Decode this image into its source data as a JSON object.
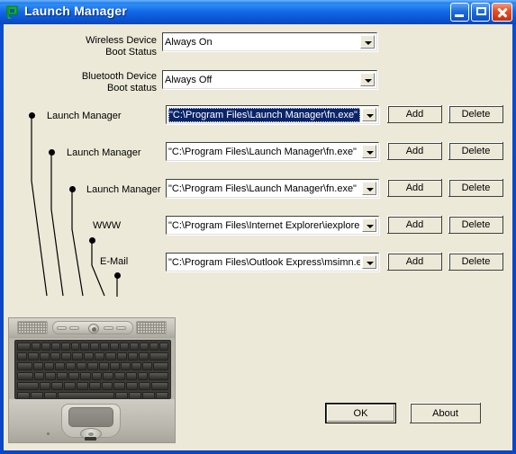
{
  "window": {
    "title": "Launch Manager",
    "icon": "launch-manager-icon",
    "titlebar_buttons": {
      "minimize": "Minimize",
      "maximize": "Maximize",
      "close": "Close"
    },
    "colors": {
      "titlebar_blue": "#1368e8",
      "frame_blue": "#0a46c8",
      "client_background": "#ece9d8",
      "selection_blue": "#0a246a",
      "close_red": "#c7300d"
    }
  },
  "form": {
    "settings": [
      {
        "label": "Wireless Device\nBoot Status",
        "value": "Always On",
        "name": "wireless-device-boot-status"
      },
      {
        "label": "Bluetooth Device\nBoot status",
        "value": "Always Off",
        "name": "bluetooth-device-boot-status"
      }
    ],
    "launch_rows": [
      {
        "label": "Launch Manager",
        "value": "\"C:\\Program Files\\Launch Manager\\fn.exe\"",
        "selected": true,
        "add_label": "Add",
        "delete_label": "Delete"
      },
      {
        "label": "Launch Manager",
        "value": "\"C:\\Program Files\\Launch Manager\\fn.exe\"",
        "selected": false,
        "add_label": "Add",
        "delete_label": "Delete"
      },
      {
        "label": "Launch Manager",
        "value": "\"C:\\Program Files\\Launch Manager\\fn.exe\"",
        "selected": false,
        "add_label": "Add",
        "delete_label": "Delete"
      },
      {
        "label": "WWW",
        "value": "\"C:\\Program Files\\Internet Explorer\\iexplore.e",
        "selected": false,
        "add_label": "Add",
        "delete_label": "Delete"
      },
      {
        "label": "E-Mail",
        "value": "\"C:\\Program Files\\Outlook Express\\msimn.ex",
        "selected": false,
        "add_label": "Add",
        "delete_label": "Delete"
      }
    ]
  },
  "footer": {
    "ok_label": "OK",
    "about_label": "About"
  },
  "illustration": {
    "name": "laptop-keyboard-photo",
    "description": "Notebook computer keyboard with launch key strip and touchpad"
  }
}
